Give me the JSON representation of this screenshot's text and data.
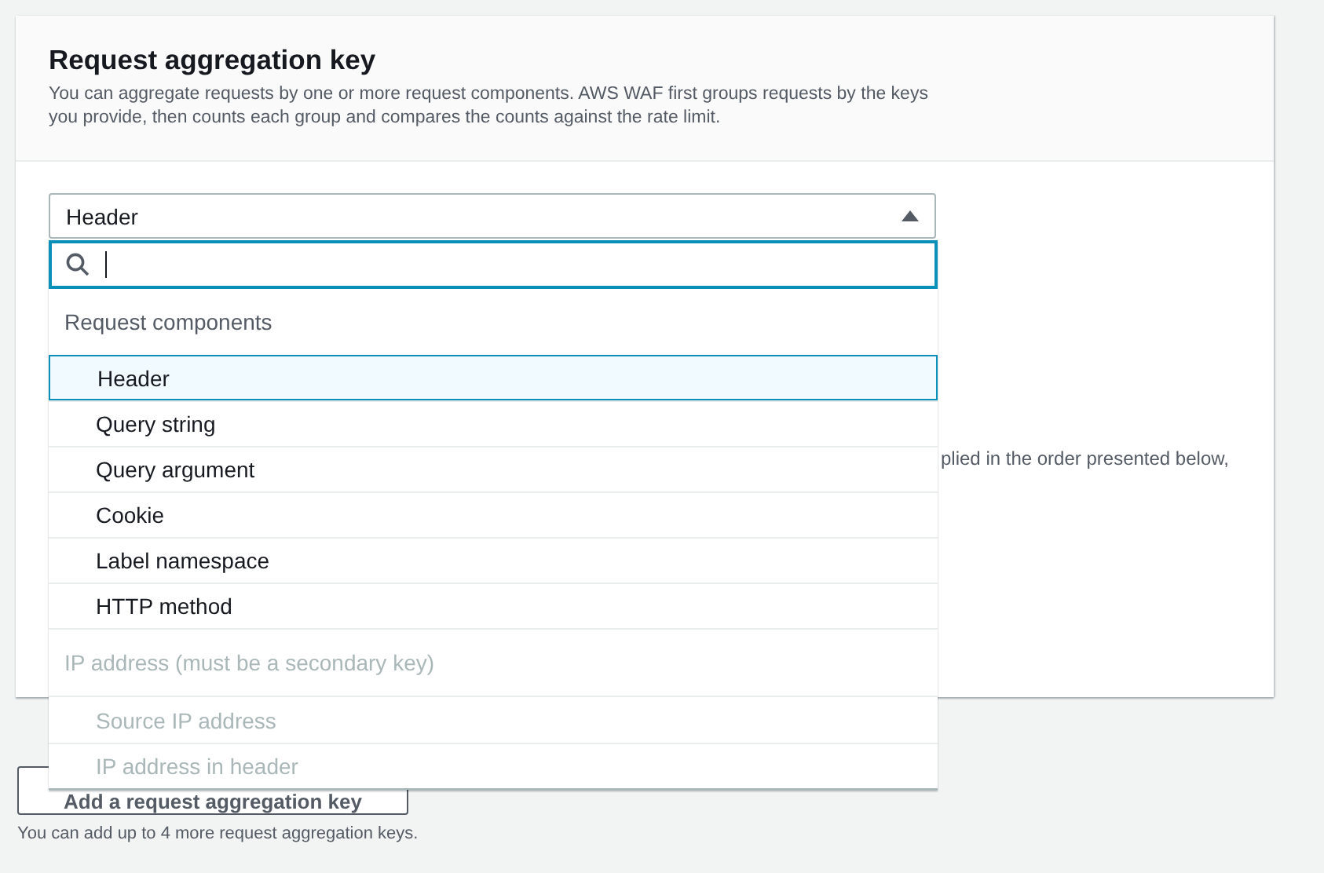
{
  "section": {
    "title": "Request aggregation key",
    "description": "You can aggregate requests by one or more request components. AWS WAF first groups requests by the keys you provide, then counts each group and compares the counts against the rate limit."
  },
  "select": {
    "value": "Header",
    "expanded": true
  },
  "dropdown": {
    "groups": [
      {
        "label": "Request components",
        "disabled": false,
        "options": [
          {
            "label": "Header",
            "selected": true,
            "disabled": false
          },
          {
            "label": "Query string",
            "selected": false,
            "disabled": false
          },
          {
            "label": "Query argument",
            "selected": false,
            "disabled": false
          },
          {
            "label": "Cookie",
            "selected": false,
            "disabled": false
          },
          {
            "label": "Label namespace",
            "selected": false,
            "disabled": false
          },
          {
            "label": "HTTP method",
            "selected": false,
            "disabled": false
          }
        ]
      },
      {
        "label": "IP address (must be a secondary key)",
        "disabled": true,
        "options": [
          {
            "label": "Source IP address",
            "selected": false,
            "disabled": true
          },
          {
            "label": "IP address in header",
            "selected": false,
            "disabled": true
          }
        ]
      }
    ]
  },
  "hidden_text_fragment": "plied in the order presented below,",
  "add_button": "Add a request aggregation key",
  "add_hint": "You can add up to 4 more request aggregation keys."
}
